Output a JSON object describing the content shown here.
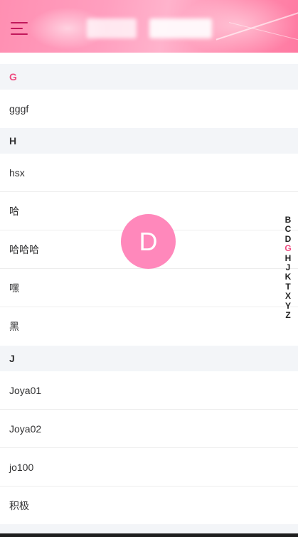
{
  "header": {
    "menu_icon": "hamburger-menu-icon",
    "accent_color": "#c2185b",
    "background_colors": [
      "#ff8fb2",
      "#ffb3cc",
      "#ff7aa2"
    ]
  },
  "list": {
    "groups": [
      {
        "letter": "G",
        "active": true,
        "items": [
          "gggf"
        ]
      },
      {
        "letter": "H",
        "active": false,
        "items": [
          "hsx",
          "哈",
          "哈哈哈",
          "嘿",
          "黑"
        ]
      },
      {
        "letter": "J",
        "active": false,
        "items": [
          "Joya01",
          "Joya02",
          "jo100",
          "积极"
        ]
      }
    ]
  },
  "index_bar": {
    "letters": [
      "B",
      "C",
      "D",
      "G",
      "H",
      "J",
      "K",
      "T",
      "X",
      "Y",
      "Z"
    ],
    "active": "G",
    "active_color": "#ee4b7f"
  },
  "indicator": {
    "letter": "D",
    "color": "#ff88bb"
  }
}
